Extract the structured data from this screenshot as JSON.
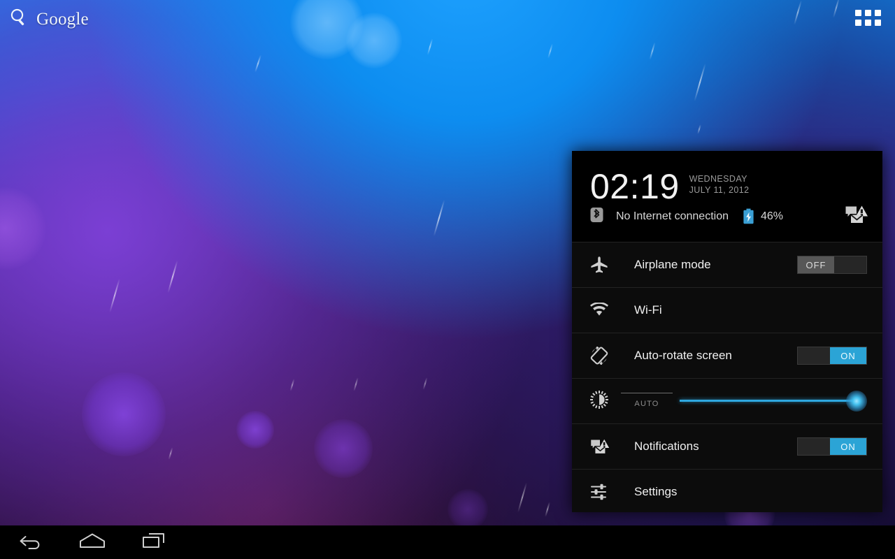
{
  "wallpaper": {
    "description": "android-nebula-bokeh-wallpaper",
    "colors": {
      "top_blue": "#0b93f6",
      "mid_purple": "#4a32a8",
      "bottom_dark": "#060210",
      "bokeh_violet": "#7b3fd4",
      "bokeh_blue": "#49b6ff"
    }
  },
  "home": {
    "search_widget": {
      "icon": "search-icon",
      "label": "Google"
    },
    "app_drawer": {
      "icon": "apps-grid-icon",
      "label": "Apps"
    }
  },
  "quick_settings": {
    "header": {
      "time": "02:19",
      "weekday": "WEDNESDAY",
      "date": "JULY 11, 2012",
      "bluetooth_icon": "bluetooth-icon",
      "connection_status": "No Internet connection",
      "battery_icon": "battery-charging-icon",
      "battery_level": "46%",
      "notifications_icon": "notifications-alert-icon"
    },
    "rows": [
      {
        "id": "airplane-mode",
        "icon": "airplane-icon",
        "label": "Airplane mode",
        "toggle": {
          "state": "off",
          "label": "OFF"
        }
      },
      {
        "id": "wifi",
        "icon": "wifi-icon",
        "label": "Wi-Fi",
        "toggle": null
      },
      {
        "id": "auto-rotate",
        "icon": "screen-rotation-icon",
        "label": "Auto-rotate screen",
        "toggle": {
          "state": "on",
          "label": "ON"
        }
      }
    ],
    "brightness": {
      "icon": "brightness-icon",
      "auto_label": "AUTO",
      "value_percent": 100
    },
    "rows_after": [
      {
        "id": "notifications",
        "icon": "notifications-alert-icon",
        "label": "Notifications",
        "toggle": {
          "state": "on",
          "label": "ON"
        }
      },
      {
        "id": "settings",
        "icon": "sliders-icon",
        "label": "Settings",
        "toggle": null
      }
    ],
    "accent_color": "#2ba4d6"
  },
  "navbar": {
    "buttons": [
      {
        "id": "back",
        "icon": "back-arrow-icon",
        "label": "Back"
      },
      {
        "id": "home",
        "icon": "home-icon",
        "label": "Home"
      },
      {
        "id": "recents",
        "icon": "recents-icon",
        "label": "Recent apps"
      }
    ]
  }
}
